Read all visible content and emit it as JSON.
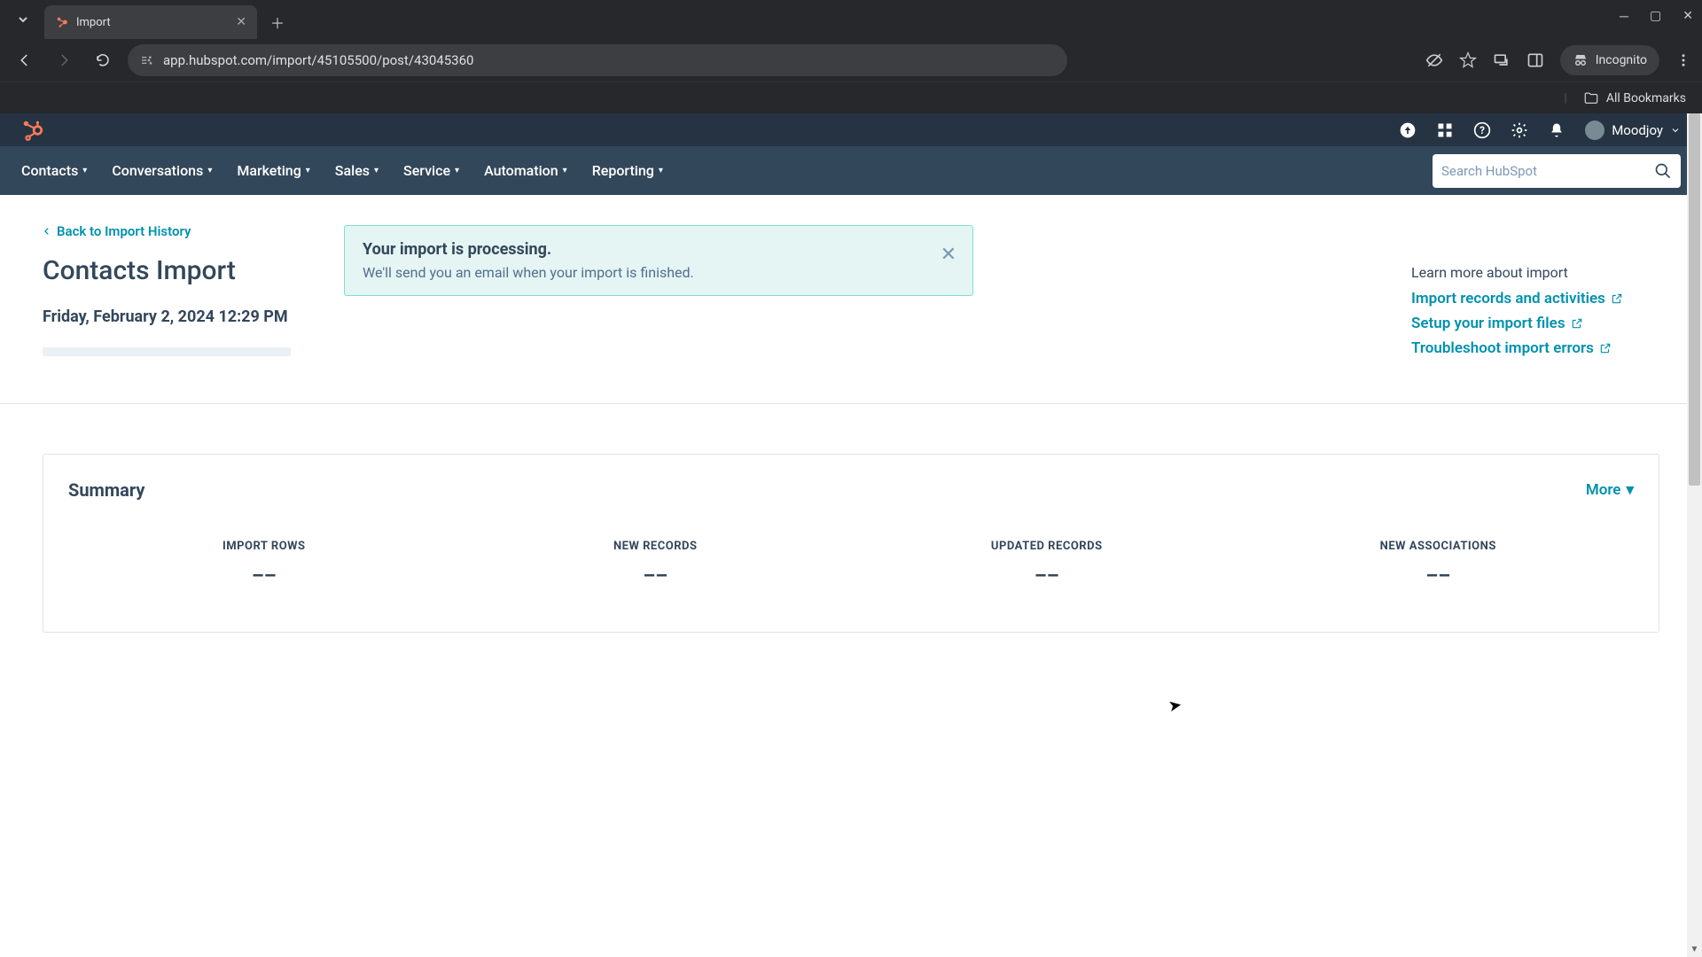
{
  "browser": {
    "tab_title": "Import",
    "url": "app.hubspot.com/import/45105500/post/43045360",
    "incognito_label": "Incognito",
    "all_bookmarks": "All Bookmarks"
  },
  "topbar": {
    "account_name": "Moodjoy"
  },
  "nav": {
    "items": [
      "Contacts",
      "Conversations",
      "Marketing",
      "Sales",
      "Service",
      "Automation",
      "Reporting"
    ],
    "search_placeholder": "Search HubSpot"
  },
  "page": {
    "back_link": "Back to Import History",
    "title": "Contacts Import",
    "timestamp": "Friday, February 2, 2024 12:29 PM"
  },
  "alert": {
    "title": "Your import is processing.",
    "body": "We'll send you an email when your import is finished."
  },
  "help": {
    "heading": "Learn more about import",
    "links": [
      "Import records and activities",
      "Setup your import files",
      "Troubleshoot import errors"
    ]
  },
  "summary": {
    "title": "Summary",
    "more_label": "More",
    "stats": [
      {
        "label": "IMPORT ROWS",
        "value": "––"
      },
      {
        "label": "NEW RECORDS",
        "value": "––"
      },
      {
        "label": "UPDATED RECORDS",
        "value": "––"
      },
      {
        "label": "NEW ASSOCIATIONS",
        "value": "––"
      }
    ]
  }
}
